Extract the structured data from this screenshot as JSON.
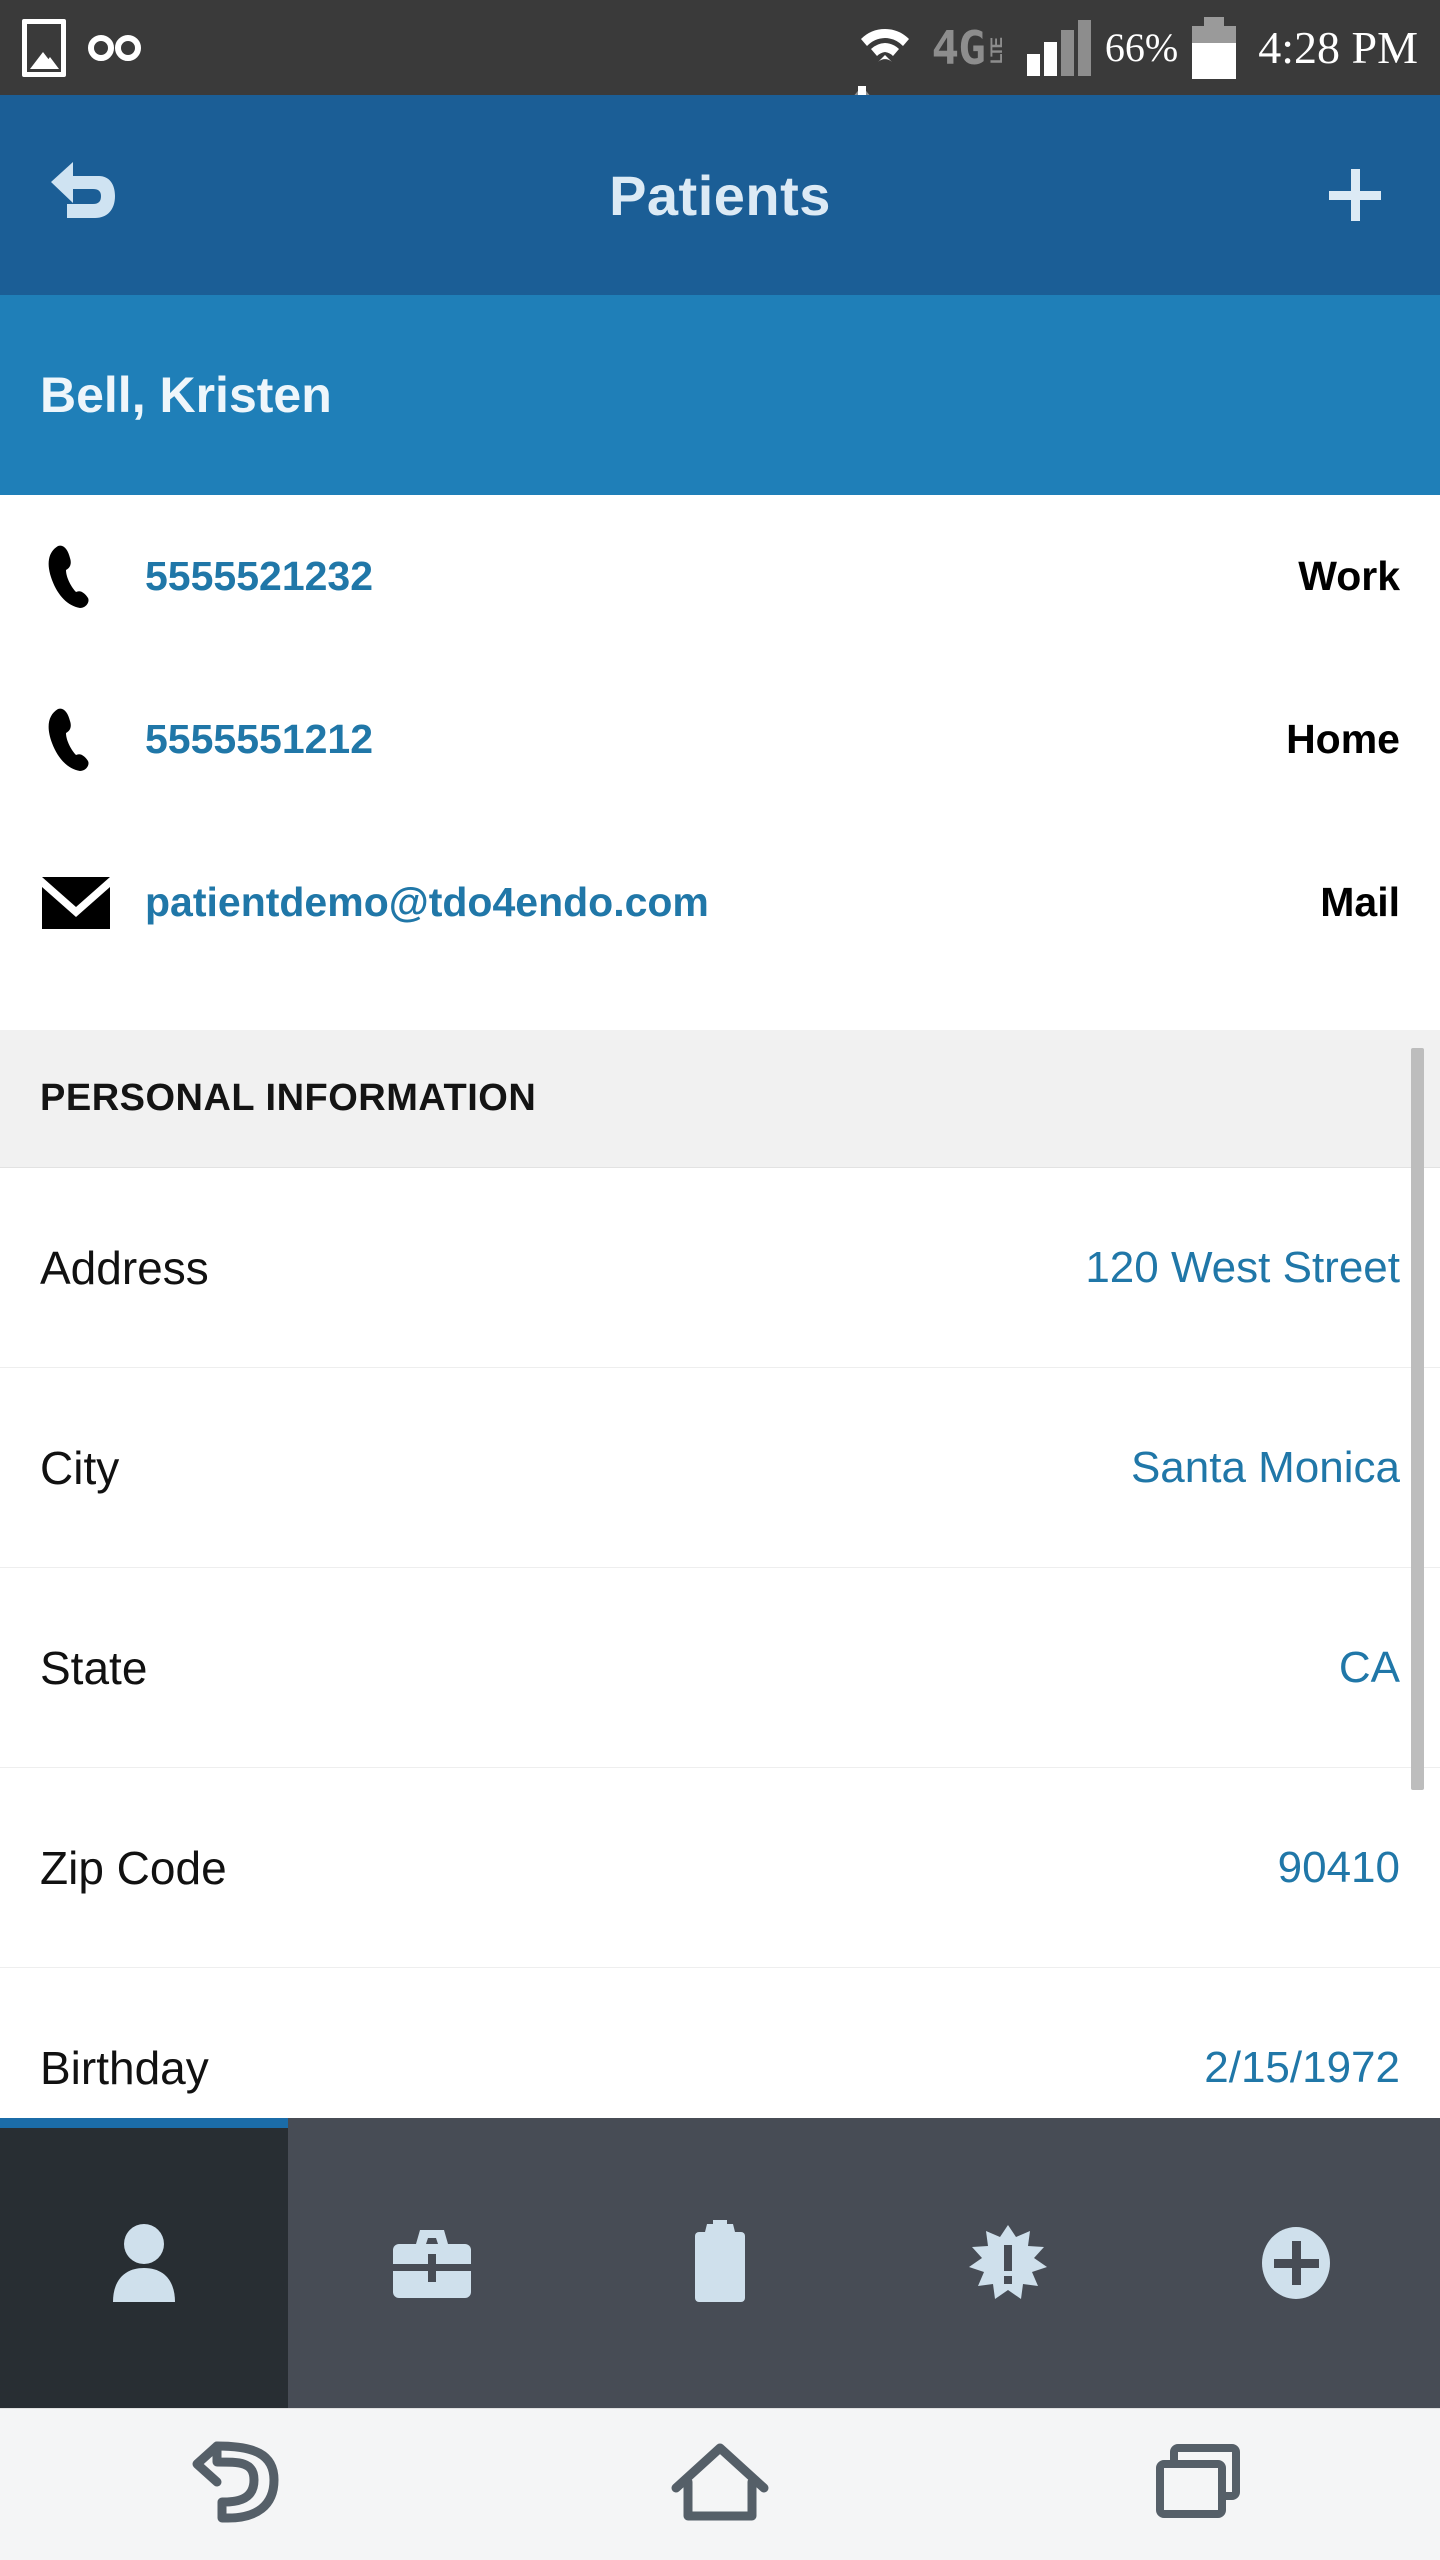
{
  "status_bar": {
    "photo_icon": "photo-icon",
    "voicemail_icon": "voicemail-icon",
    "wifi_icon": "wifi-icon",
    "data_arrows_icon": "data-transfer-icon",
    "network_type": "4G",
    "network_suffix": "LTE",
    "signal_icon": "cell-signal-icon",
    "battery_percent": "66%",
    "battery_icon": "battery-icon",
    "time": "4:28 PM"
  },
  "app_bar": {
    "back_icon": "back-arrow-icon",
    "title": "Patients",
    "add_icon": "plus-icon"
  },
  "patient": {
    "name": "Bell, Kristen"
  },
  "contacts": [
    {
      "icon": "phone-icon",
      "value": "5555521232",
      "type": "Work"
    },
    {
      "icon": "phone-icon",
      "value": "5555551212",
      "type": "Home"
    },
    {
      "icon": "mail-icon",
      "value": "patientdemo@tdo4endo.com",
      "type": "Mail"
    }
  ],
  "section": {
    "title": "PERSONAL INFORMATION"
  },
  "info_rows": [
    {
      "label": "Address",
      "value": "120 West Street"
    },
    {
      "label": "City",
      "value": "Santa Monica"
    },
    {
      "label": "State",
      "value": "CA"
    },
    {
      "label": "Zip Code",
      "value": "90410"
    },
    {
      "label": "Birthday",
      "value": "2/15/1972"
    }
  ],
  "tabs": [
    {
      "name": "tab-patient",
      "icon": "person-icon",
      "active": true
    },
    {
      "name": "tab-practice",
      "icon": "medical-briefcase-icon",
      "active": false
    },
    {
      "name": "tab-chart",
      "icon": "clipboard-icon",
      "active": false
    },
    {
      "name": "tab-alerts",
      "icon": "alert-burst-icon",
      "active": false
    },
    {
      "name": "tab-add",
      "icon": "plus-circle-icon",
      "active": false
    }
  ],
  "nav_bar": {
    "back_icon": "nav-back-icon",
    "home_icon": "nav-home-icon",
    "recents_icon": "nav-recents-icon"
  },
  "colors": {
    "app_bar": "#1b5e96",
    "name_band": "#1f7fb8",
    "link": "#2077a8",
    "tab_active_bg": "#282e33",
    "tab_inactive_bg": "#474c55",
    "tab_indicator": "#1b6ca8",
    "section_bg": "#f1f1f1"
  }
}
